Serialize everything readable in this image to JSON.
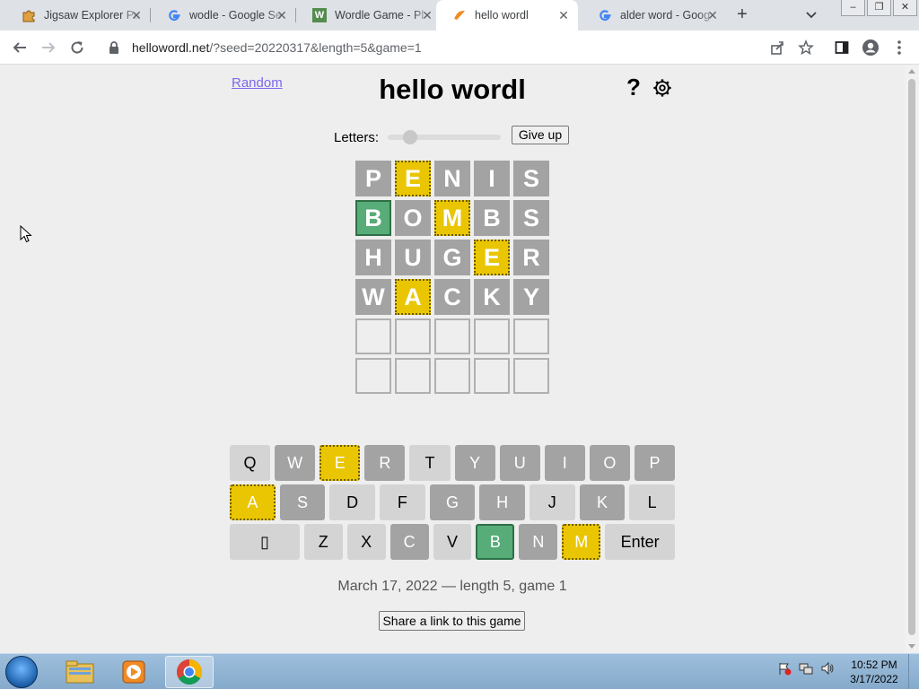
{
  "browser": {
    "tabs": [
      {
        "title": "Jigsaw Explorer Pu",
        "icon": "puzzle-icon"
      },
      {
        "title": "wodle - Google Se",
        "icon": "google-icon"
      },
      {
        "title": "Wordle Game - Pl",
        "icon": "wordle-w-icon"
      },
      {
        "title": "hello wordl",
        "icon": "hello-wordl-icon",
        "active": true
      },
      {
        "title": "alder word - Goog",
        "icon": "google-icon"
      }
    ],
    "url_host": "hellowordl.net",
    "url_path": "/?seed=20220317&length=5&game=1"
  },
  "page": {
    "random_label": "Random",
    "title": "hello wordl",
    "help_label": "?",
    "letters_label": "Letters:",
    "letters_slider_fraction": 0.15,
    "give_up_label": "Give up",
    "board": [
      [
        {
          "l": "P",
          "s": "absent"
        },
        {
          "l": "E",
          "s": "elsewhere"
        },
        {
          "l": "N",
          "s": "absent"
        },
        {
          "l": "I",
          "s": "absent"
        },
        {
          "l": "S",
          "s": "absent"
        }
      ],
      [
        {
          "l": "B",
          "s": "correct"
        },
        {
          "l": "O",
          "s": "absent"
        },
        {
          "l": "M",
          "s": "elsewhere"
        },
        {
          "l": "B",
          "s": "absent"
        },
        {
          "l": "S",
          "s": "absent"
        }
      ],
      [
        {
          "l": "H",
          "s": "absent"
        },
        {
          "l": "U",
          "s": "absent"
        },
        {
          "l": "G",
          "s": "absent"
        },
        {
          "l": "E",
          "s": "elsewhere"
        },
        {
          "l": "R",
          "s": "absent"
        }
      ],
      [
        {
          "l": "W",
          "s": "absent"
        },
        {
          "l": "A",
          "s": "elsewhere"
        },
        {
          "l": "C",
          "s": "absent"
        },
        {
          "l": "K",
          "s": "absent"
        },
        {
          "l": "Y",
          "s": "absent"
        }
      ],
      [
        {
          "l": "",
          "s": "empty"
        },
        {
          "l": "",
          "s": "empty"
        },
        {
          "l": "",
          "s": "empty"
        },
        {
          "l": "",
          "s": "empty"
        },
        {
          "l": "",
          "s": "empty"
        }
      ],
      [
        {
          "l": "",
          "s": "empty"
        },
        {
          "l": "",
          "s": "empty"
        },
        {
          "l": "",
          "s": "empty"
        },
        {
          "l": "",
          "s": "empty"
        },
        {
          "l": "",
          "s": "empty"
        }
      ]
    ],
    "keyboard": [
      [
        {
          "k": "Q",
          "s": "unused"
        },
        {
          "k": "W",
          "s": "absent"
        },
        {
          "k": "E",
          "s": "elsewhere"
        },
        {
          "k": "R",
          "s": "absent"
        },
        {
          "k": "T",
          "s": "unused"
        },
        {
          "k": "Y",
          "s": "absent"
        },
        {
          "k": "U",
          "s": "absent"
        },
        {
          "k": "I",
          "s": "absent"
        },
        {
          "k": "O",
          "s": "absent"
        },
        {
          "k": "P",
          "s": "absent"
        }
      ],
      [
        {
          "k": "A",
          "s": "elsewhere"
        },
        {
          "k": "S",
          "s": "absent"
        },
        {
          "k": "D",
          "s": "unused"
        },
        {
          "k": "F",
          "s": "unused"
        },
        {
          "k": "G",
          "s": "absent"
        },
        {
          "k": "H",
          "s": "absent"
        },
        {
          "k": "J",
          "s": "unused"
        },
        {
          "k": "K",
          "s": "absent"
        },
        {
          "k": "L",
          "s": "unused"
        }
      ],
      [
        {
          "k": "▯",
          "s": "unused",
          "name": "backspace"
        },
        {
          "k": "Z",
          "s": "unused"
        },
        {
          "k": "X",
          "s": "unused"
        },
        {
          "k": "C",
          "s": "absent"
        },
        {
          "k": "V",
          "s": "unused"
        },
        {
          "k": "B",
          "s": "correct"
        },
        {
          "k": "N",
          "s": "absent"
        },
        {
          "k": "M",
          "s": "elsewhere"
        },
        {
          "k": "Enter",
          "s": "unused",
          "name": "enter"
        }
      ]
    ],
    "game_info": "March 17, 2022 — length 5, game 1",
    "share_label": "Share a link to this game"
  },
  "taskbar": {
    "time": "10:52 PM",
    "date": "3/17/2022"
  },
  "colors": {
    "correct": "#57ac78",
    "elsewhere": "#e9c601",
    "absent": "#a3a3a3",
    "link": "#7b68ee"
  }
}
